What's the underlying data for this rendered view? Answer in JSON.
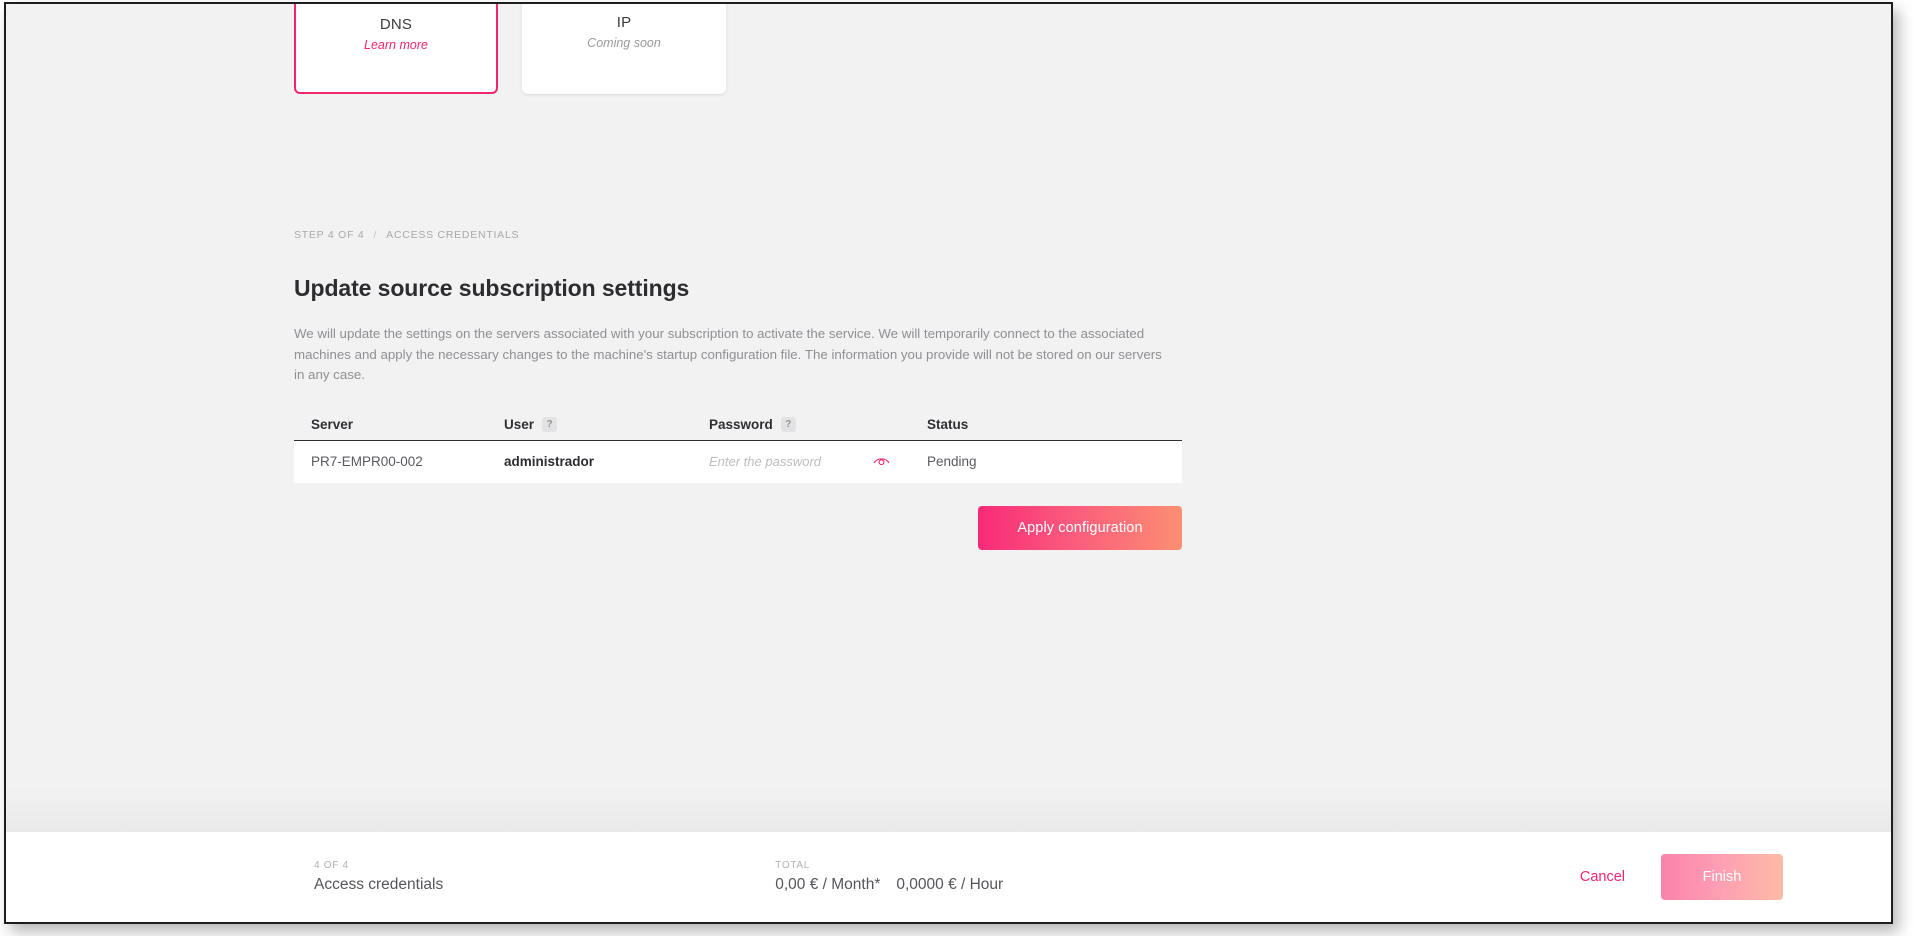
{
  "service_cards": [
    {
      "id": "dns",
      "icon": "globe-icon",
      "label": "DNS",
      "sub": "Learn more",
      "sub_kind": "link",
      "selected": true
    },
    {
      "id": "ip",
      "icon": "shield-ip-icon",
      "label": "IP",
      "sub": "Coming soon",
      "sub_kind": "muted",
      "selected": false
    }
  ],
  "breadcrumb": {
    "step": "STEP 4 OF 4",
    "separator": "/",
    "current": "ACCESS CREDENTIALS"
  },
  "page_title": "Update source subscription settings",
  "page_description": "We will update the settings on the servers associated with your subscription to activate the service. We will temporarily connect to the associated machines and apply the necessary changes to the machine's startup configuration file. The information you provide will not be stored on our servers in any case.",
  "table": {
    "columns": [
      {
        "label": "Server",
        "help": false
      },
      {
        "label": "User",
        "help": true,
        "help_glyph": "?"
      },
      {
        "label": "Password",
        "help": true,
        "help_glyph": "?"
      },
      {
        "label": "Status",
        "help": false
      }
    ],
    "rows": [
      {
        "server": "PR7-EMPR00-002",
        "user": "administrador",
        "password_value": "",
        "password_placeholder": "Enter the password",
        "reveal_icon": "eye-icon",
        "status": "Pending"
      }
    ]
  },
  "apply_button": "Apply configuration",
  "footer": {
    "step_kicker": "4 OF 4",
    "step_label": "Access credentials",
    "total_kicker": "TOTAL",
    "total_month": "0,00 € / Month*",
    "total_hour": "0,0000 € / Hour",
    "cancel_label": "Cancel",
    "finish_label": "Finish"
  },
  "colors": {
    "accent_pink": "#f2256f",
    "gradient_start": "#f72a78",
    "gradient_end": "#fb8f72",
    "page_bg": "#f2f2f2",
    "text_dark": "#2c2c31",
    "text_muted": "#8f8f95"
  }
}
